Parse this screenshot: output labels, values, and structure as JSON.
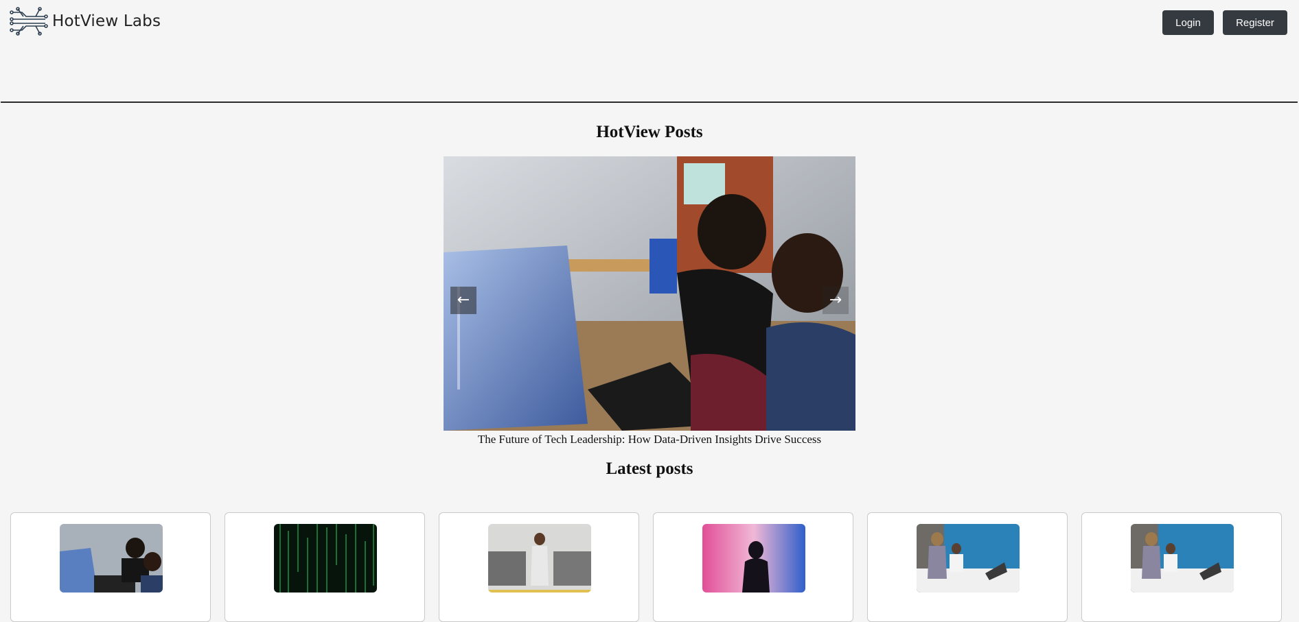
{
  "brand": {
    "name": "HotView Labs",
    "logo_icon": "circuit-lines-icon"
  },
  "auth": {
    "login_label": "Login",
    "register_label": "Register"
  },
  "featured": {
    "heading": "HotView Posts",
    "caption": "The Future of Tech Leadership: How Data-Driven Insights Drive Success",
    "prev_icon": "←",
    "next_icon": "→"
  },
  "latest": {
    "heading": "Latest posts",
    "cards": [
      {
        "image": "team-at-laptop-photo"
      },
      {
        "image": "green-code-rain-photo"
      },
      {
        "image": "woman-in-lab-photo"
      },
      {
        "image": "woman-silhouette-photo"
      },
      {
        "image": "lab-workers-photo"
      },
      {
        "image": "lab-workers-photo"
      }
    ]
  },
  "colors": {
    "button_bg": "#343a40",
    "page_bg": "#f5f5f5",
    "divider": "#2b2b2b"
  }
}
